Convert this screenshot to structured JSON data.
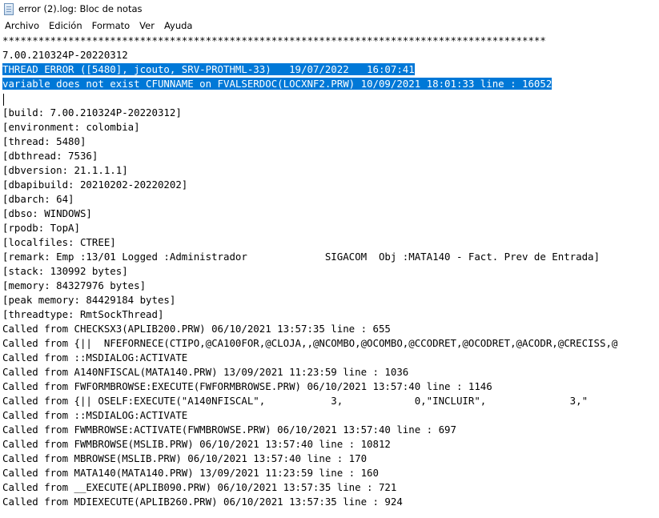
{
  "window": {
    "title": "error (2).log: Bloc de notas"
  },
  "menu": [
    "Archivo",
    "Edición",
    "Formato",
    "Ver",
    "Ayuda"
  ],
  "editor": {
    "lines": [
      {
        "text": "*******************************************************************************************",
        "selected": false
      },
      {
        "text": "7.00.210324P-20220312",
        "selected": false
      },
      {
        "text": "THREAD ERROR ([5480], jcouto, SRV-PROTHML-33)   19/07/2022   16:07:41",
        "selected": true
      },
      {
        "text": "variable does not exist CFUNNAME on FVALSERDOC(LOCXNF2.PRW) 10/09/2021 18:01:33 line : 16052",
        "selected": true
      },
      {
        "text": "",
        "selected": false
      },
      {
        "text": "[build: 7.00.210324P-20220312]",
        "selected": false
      },
      {
        "text": "[environment: colombia]",
        "selected": false
      },
      {
        "text": "[thread: 5480]",
        "selected": false
      },
      {
        "text": "[dbthread: 7536]",
        "selected": false
      },
      {
        "text": "[dbversion: 21.1.1.1]",
        "selected": false
      },
      {
        "text": "[dbapibuild: 20210202-20220202]",
        "selected": false
      },
      {
        "text": "[dbarch: 64]",
        "selected": false
      },
      {
        "text": "[dbso: WINDOWS]",
        "selected": false
      },
      {
        "text": "[rpodb: TopA]",
        "selected": false
      },
      {
        "text": "[localfiles: CTREE]",
        "selected": false
      },
      {
        "text": "[remark: Emp :13/01 Logged :Administrador             SIGACOM  Obj :MATA140 - Fact. Prev de Entrada]",
        "selected": false
      },
      {
        "text": "[stack: 130992 bytes]",
        "selected": false
      },
      {
        "text": "[memory: 84327976 bytes]",
        "selected": false
      },
      {
        "text": "[peak memory: 84429184 bytes]",
        "selected": false
      },
      {
        "text": "[threadtype: RmtSockThread]",
        "selected": false
      },
      {
        "text": "Called from CHECKSX3(APLIB200.PRW) 06/10/2021 13:57:35 line : 655",
        "selected": false
      },
      {
        "text": "Called from {||  NFEFORNECE(CTIPO,@CA100FOR,@CLOJA,,@NCOMBO,@OCOMBO,@CCODRET,@OCODRET,@ACODR,@CRECISS,@",
        "selected": false
      },
      {
        "text": "Called from ::MSDIALOG:ACTIVATE",
        "selected": false
      },
      {
        "text": "Called from A140NFISCAL(MATA140.PRW) 13/09/2021 11:23:59 line : 1036",
        "selected": false
      },
      {
        "text": "Called from FWFORMBROWSE:EXECUTE(FWFORMBROWSE.PRW) 06/10/2021 13:57:40 line : 1146",
        "selected": false
      },
      {
        "text": "Called from {|| OSELF:EXECUTE(\"A140NFISCAL\",           3,            0,\"INCLUIR\",              3,\"",
        "selected": false
      },
      {
        "text": "Called from ::MSDIALOG:ACTIVATE",
        "selected": false
      },
      {
        "text": "Called from FWMBROWSE:ACTIVATE(FWMBROWSE.PRW) 06/10/2021 13:57:40 line : 697",
        "selected": false
      },
      {
        "text": "Called from FWMBROWSE(MSLIB.PRW) 06/10/2021 13:57:40 line : 10812",
        "selected": false
      },
      {
        "text": "Called from MBROWSE(MSLIB.PRW) 06/10/2021 13:57:40 line : 170",
        "selected": false
      },
      {
        "text": "Called from MATA140(MATA140.PRW) 13/09/2021 11:23:59 line : 160",
        "selected": false
      },
      {
        "text": "Called from __EXECUTE(APLIB090.PRW) 06/10/2021 13:57:35 line : 721",
        "selected": false
      },
      {
        "text": "Called from MDIEXECUTE(APLIB260.PRW) 06/10/2021 13:57:35 line : 924",
        "selected": false
      }
    ]
  }
}
